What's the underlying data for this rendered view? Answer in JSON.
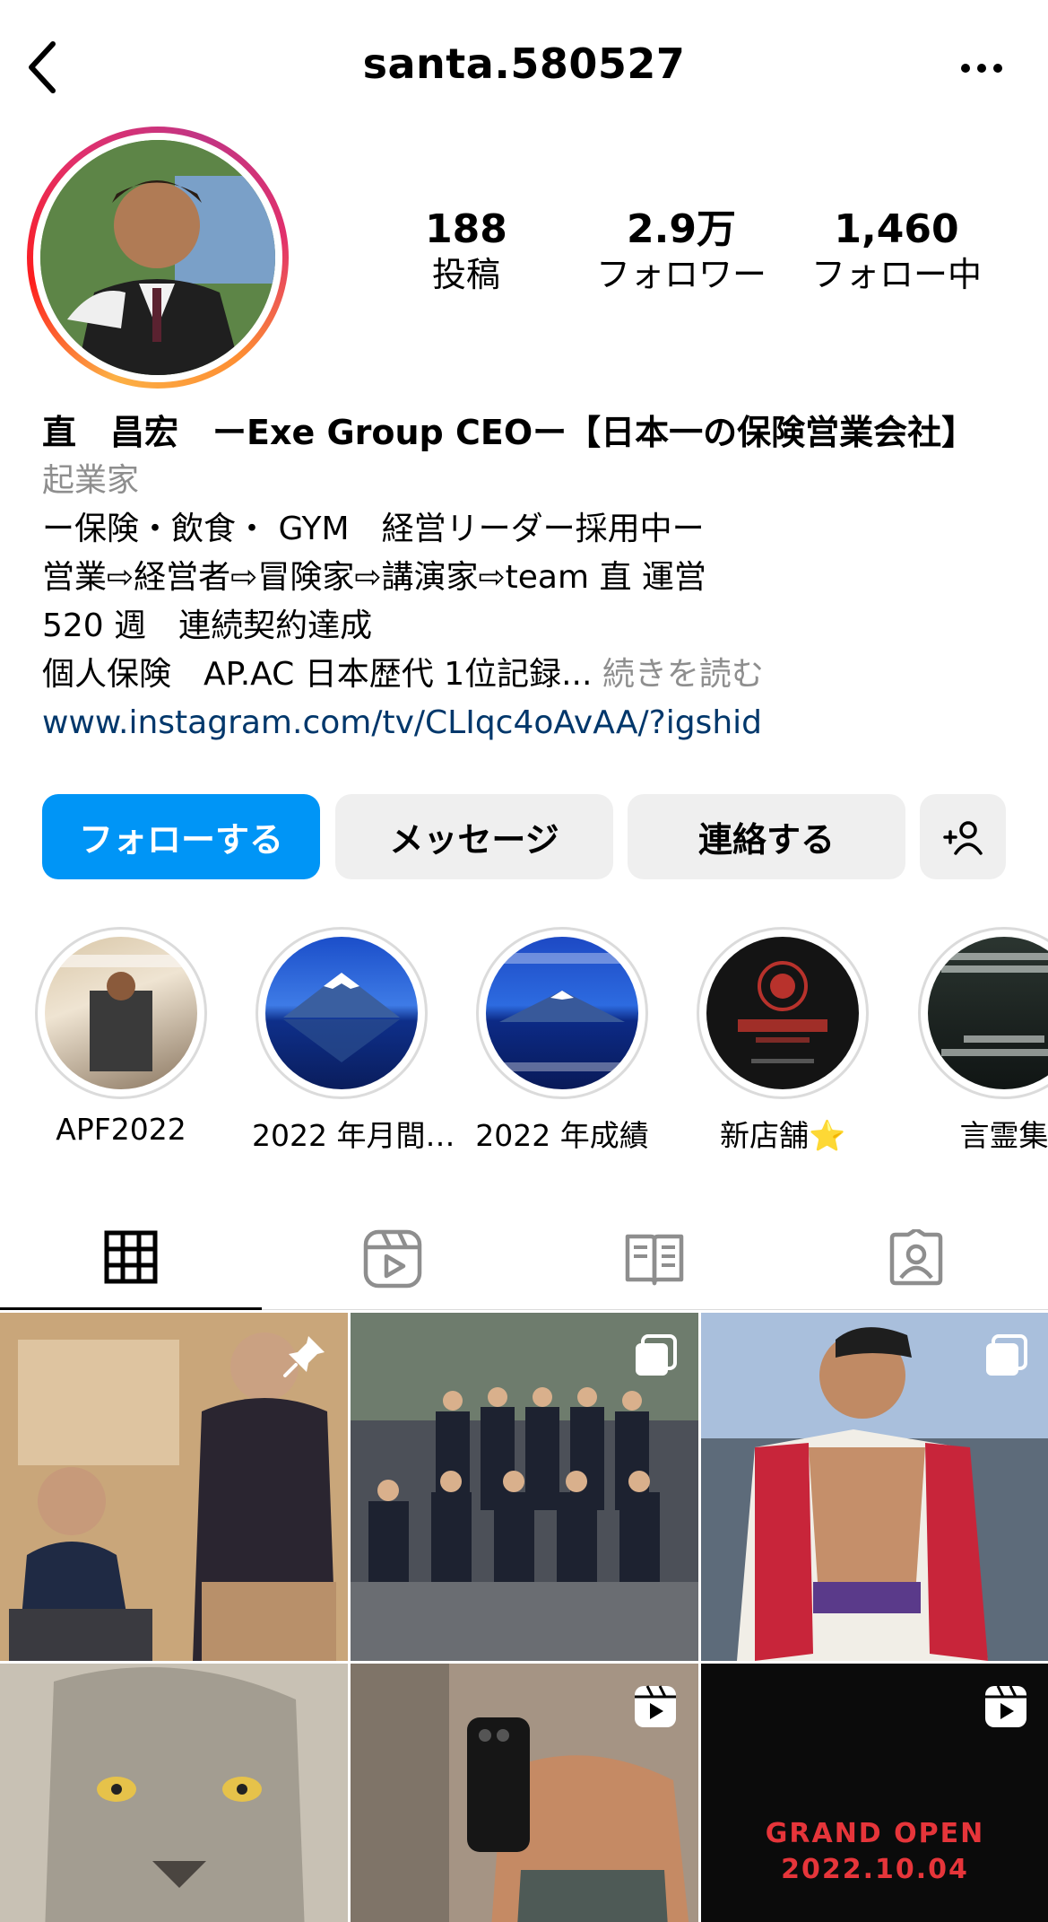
{
  "header": {
    "username": "santa.580527",
    "back_icon": "chevron-left-icon",
    "more_icon": "more-horizontal-icon"
  },
  "stats": {
    "posts": {
      "value": "188",
      "label": "投稿"
    },
    "followers": {
      "value": "2.9万",
      "label": "フォロワー"
    },
    "following": {
      "value": "1,460",
      "label": "フォロー中"
    }
  },
  "bio": {
    "name": "直　昌宏　ーExe Group CEOー【日本一の保険営業会社】",
    "category": "起業家",
    "lines": [
      "ー保険・飲食・ GYM　経営リーダー採用中ー",
      "営業⇨経営者⇨冒険家⇨講演家⇨team 直 運営",
      "520 週　連続契約達成",
      "個人保険　AP.AC 日本歴代 1位記録..."
    ],
    "more_label": "続きを読む",
    "link": "www.instagram.com/tv/CLIqc4oAvAA/?igshid"
  },
  "actions": {
    "follow_label": "フォローする",
    "message_label": "メッセージ",
    "contact_label": "連絡する",
    "add_user_icon": "add-user-icon"
  },
  "highlights": [
    {
      "label": "APF2022"
    },
    {
      "label": "2022 年月間…"
    },
    {
      "label": "2022 年成績"
    },
    {
      "label": "新店舗⭐"
    },
    {
      "label": "言霊集"
    }
  ],
  "tabs": [
    {
      "icon": "grid-icon"
    },
    {
      "icon": "reels-icon"
    },
    {
      "icon": "guides-icon"
    },
    {
      "icon": "tagged-icon"
    }
  ],
  "grid": {
    "grand_open_line1": "GRAND OPEN",
    "grand_open_line2": "2022.10.04"
  },
  "colors": {
    "primary_button": "#0095f6",
    "secondary_button": "#efefef",
    "link": "#00376b",
    "muted_text": "#8e8e8e"
  }
}
